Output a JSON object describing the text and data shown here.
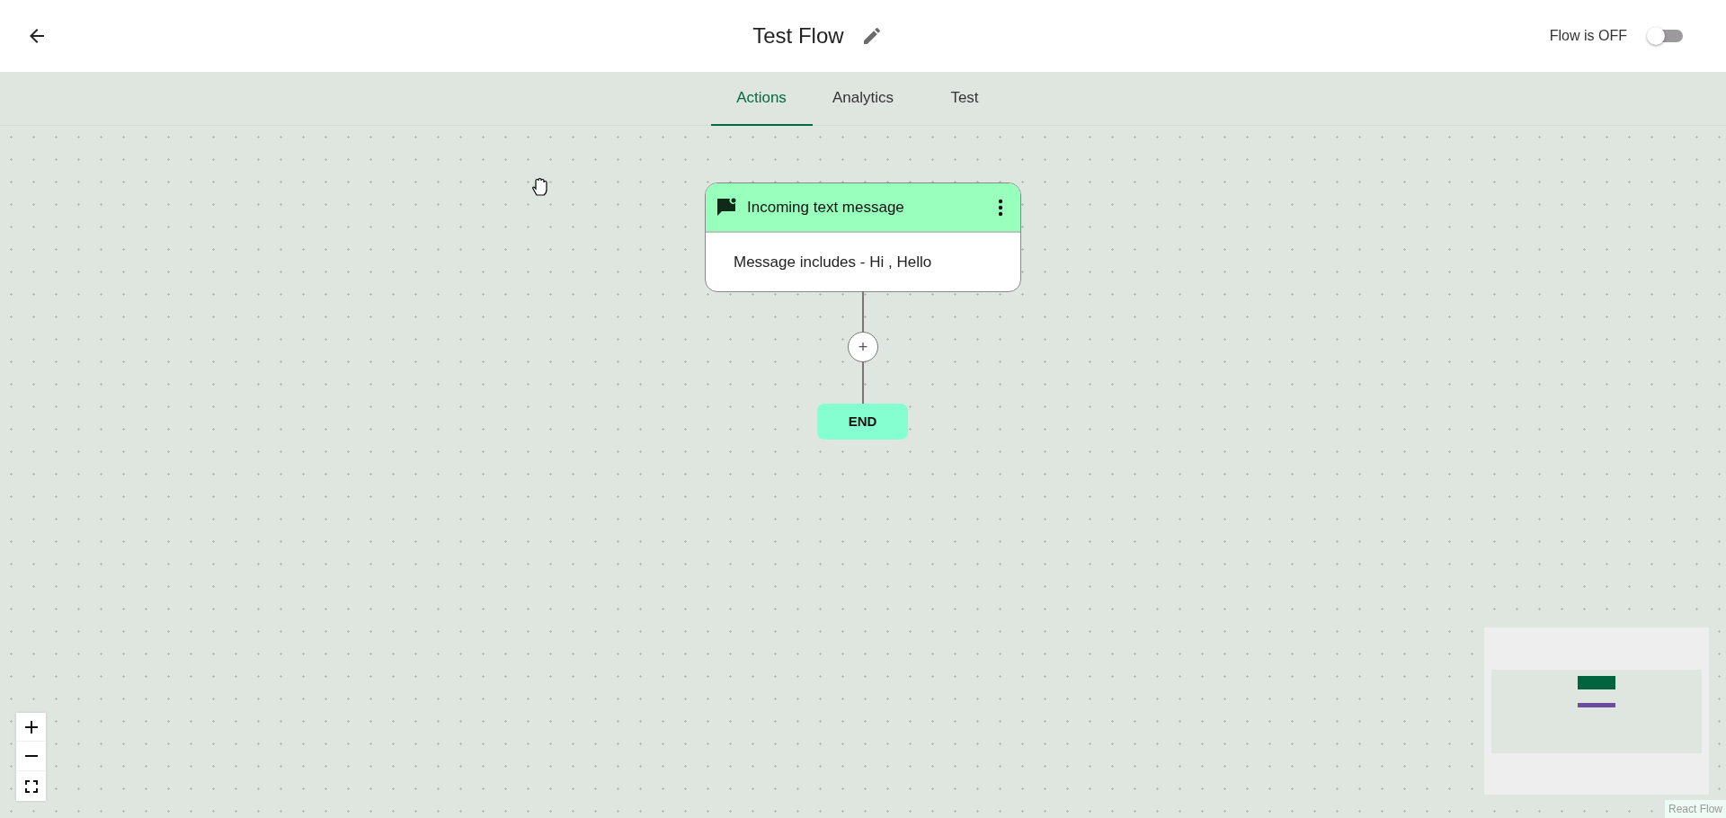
{
  "header": {
    "title": "Test Flow",
    "status_label": "Flow is OFF",
    "flow_on": false
  },
  "tabs": [
    {
      "label": "Actions",
      "selected": true
    },
    {
      "label": "Analytics",
      "selected": false
    },
    {
      "label": "Test",
      "selected": false
    }
  ],
  "flow": {
    "trigger": {
      "title": "Incoming text message",
      "body": "Message includes - Hi , Hello"
    },
    "add_label": "+",
    "end_label": "END"
  },
  "attribution": "React Flow"
}
